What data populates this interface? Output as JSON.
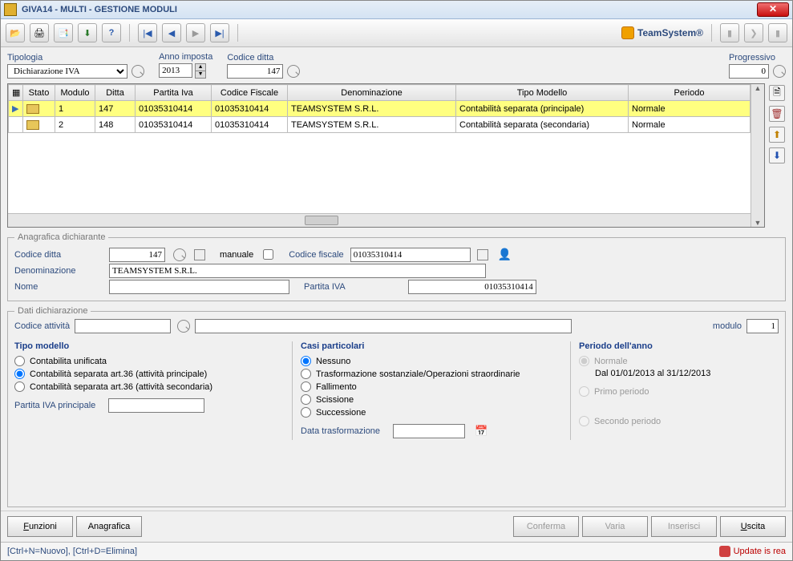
{
  "title": "GIVA14  - MULTI -  GESTIONE MODULI",
  "brand": "TeamSystem®",
  "filters": {
    "tipologia_label": "Tipologia",
    "tipologia_value": "Dichiarazione IVA",
    "anno_label": "Anno imposta",
    "anno_value": "2013",
    "codice_ditta_label": "Codice ditta",
    "codice_ditta_value": "147",
    "progressivo_label": "Progressivo",
    "progressivo_value": "0"
  },
  "grid": {
    "headers": {
      "stato": "Stato",
      "modulo": "Modulo",
      "ditta": "Ditta",
      "piva": "Partita Iva",
      "cf": "Codice Fiscale",
      "denom": "Denominazione",
      "tipo": "Tipo Modello",
      "periodo": "Periodo"
    },
    "rows": [
      {
        "selected": true,
        "modulo": "1",
        "ditta": "147",
        "piva": "01035310414",
        "cf": "01035310414",
        "denom": "TEAMSYSTEM S.R.L.",
        "tipo": "Contabilità separata (principale)",
        "periodo": "Normale"
      },
      {
        "selected": false,
        "modulo": "2",
        "ditta": "148",
        "piva": "01035310414",
        "cf": "01035310414",
        "denom": "TEAMSYSTEM S.R.L.",
        "tipo": "Contabilità separata (secondaria)",
        "periodo": "Normale"
      }
    ]
  },
  "anagrafica": {
    "legend": "Anagrafica dichiarante",
    "codice_ditta_label": "Codice ditta",
    "codice_ditta_value": "147",
    "manuale_label": "manuale",
    "cf_label": "Codice fiscale",
    "cf_value": "01035310414",
    "denom_label": "Denominazione",
    "denom_value": "TEAMSYSTEM S.R.L.",
    "nome_label": "Nome",
    "nome_value": "",
    "piva_label": "Partita IVA",
    "piva_value": "01035310414"
  },
  "dati": {
    "legend": "Dati dichiarazione",
    "codatt_label": "Codice attività",
    "codatt_value": "",
    "desc_value": "",
    "modulo_label": "modulo",
    "modulo_value": "1",
    "tipo_h": "Tipo modello",
    "tipo_opts": {
      "unificata": "Contabilita unificata",
      "principale": "Contabilità separata art.36 (attività principale)",
      "secondaria": "Contabilità separata art.36 (attività secondaria)"
    },
    "piva_princ_label": "Partita IVA principale",
    "piva_princ_value": "",
    "casi_h": "Casi particolari",
    "casi_opts": {
      "nessuno": "Nessuno",
      "trasf": "Trasformazione sostanziale/Operazioni straordinarie",
      "fall": "Fallimento",
      "sciss": "Scissione",
      "succ": "Successione"
    },
    "data_trasf_label": "Data trasformazione",
    "data_trasf_value": "",
    "periodo_h": "Periodo dell'anno",
    "periodo_opts": {
      "normale": "Normale",
      "primo": "Primo periodo",
      "secondo": "Secondo periodo"
    },
    "periodo_range": "Dal 01/01/2013 al 31/12/2013"
  },
  "buttons": {
    "funzioni": "Funzioni",
    "anagrafica": "Anagrafica",
    "conferma": "Conferma",
    "varia": "Varia",
    "inserisci": "Inserisci",
    "uscita": "Uscita"
  },
  "status": {
    "shortcuts": "[Ctrl+N=Nuovo], [Ctrl+D=Elimina]",
    "update": "Update is rea"
  }
}
